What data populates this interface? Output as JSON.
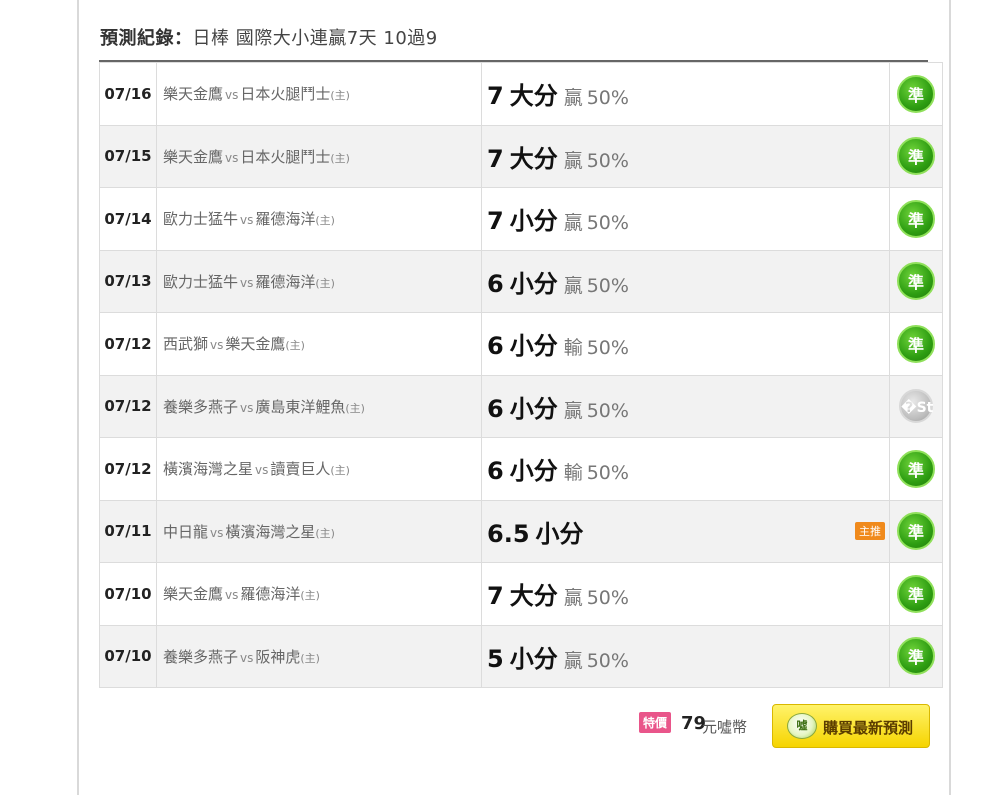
{
  "heading": {
    "label": "預測紀錄：",
    "desc": "日棒 國際大小連贏7天 10過9"
  },
  "vs_text": "vs",
  "home_mark": "(主)",
  "records": [
    {
      "date": "07/16",
      "away": "樂天金鷹",
      "home": "日本火腿鬥士",
      "line": "7",
      "kind": "大分",
      "outcome": "贏",
      "pct": "50%",
      "tag": "",
      "result": "準",
      "result_type": "good"
    },
    {
      "date": "07/15",
      "away": "樂天金鷹",
      "home": "日本火腿鬥士",
      "line": "7",
      "kind": "大分",
      "outcome": "贏",
      "pct": "50%",
      "tag": "",
      "result": "準",
      "result_type": "good"
    },
    {
      "date": "07/14",
      "away": "歐力士猛牛",
      "home": "羅德海洋",
      "line": "7",
      "kind": "小分",
      "outcome": "贏",
      "pct": "50%",
      "tag": "",
      "result": "準",
      "result_type": "good"
    },
    {
      "date": "07/13",
      "away": "歐力士猛牛",
      "home": "羅德海洋",
      "line": "6",
      "kind": "小分",
      "outcome": "贏",
      "pct": "50%",
      "tag": "",
      "result": "準",
      "result_type": "good"
    },
    {
      "date": "07/12",
      "away": "西武獅",
      "home": "樂天金鷹",
      "line": "6",
      "kind": "小分",
      "outcome": "輸",
      "pct": "50%",
      "tag": "",
      "result": "準",
      "result_type": "good"
    },
    {
      "date": "07/12",
      "away": "養樂多燕子",
      "home": "廣島東洋鯉魚",
      "line": "6",
      "kind": "小分",
      "outcome": "贏",
      "pct": "50%",
      "tag": "",
      "result": "�St",
      "result_type": "void"
    },
    {
      "date": "07/12",
      "away": "橫濱海灣之星",
      "home": "讀賣巨人",
      "line": "6",
      "kind": "小分",
      "outcome": "輸",
      "pct": "50%",
      "tag": "",
      "result": "準",
      "result_type": "good"
    },
    {
      "date": "07/11",
      "away": "中日龍",
      "home": "橫濱海灣之星",
      "line": "6.5",
      "kind": "小分",
      "outcome": "",
      "pct": "",
      "tag": "主推",
      "result": "準",
      "result_type": "good"
    },
    {
      "date": "07/10",
      "away": "樂天金鷹",
      "home": "羅德海洋",
      "line": "7",
      "kind": "大分",
      "outcome": "贏",
      "pct": "50%",
      "tag": "",
      "result": "準",
      "result_type": "good"
    },
    {
      "date": "07/10",
      "away": "養樂多燕子",
      "home": "阪神虎",
      "line": "5",
      "kind": "小分",
      "outcome": "贏",
      "pct": "50%",
      "tag": "",
      "result": "準",
      "result_type": "good"
    }
  ],
  "purchase": {
    "special_label": "特價",
    "price": "79",
    "currency": "元噓幣",
    "icon_text": "噓",
    "button_label": "購買最新預測",
    "icon_name": "coin-icon"
  }
}
